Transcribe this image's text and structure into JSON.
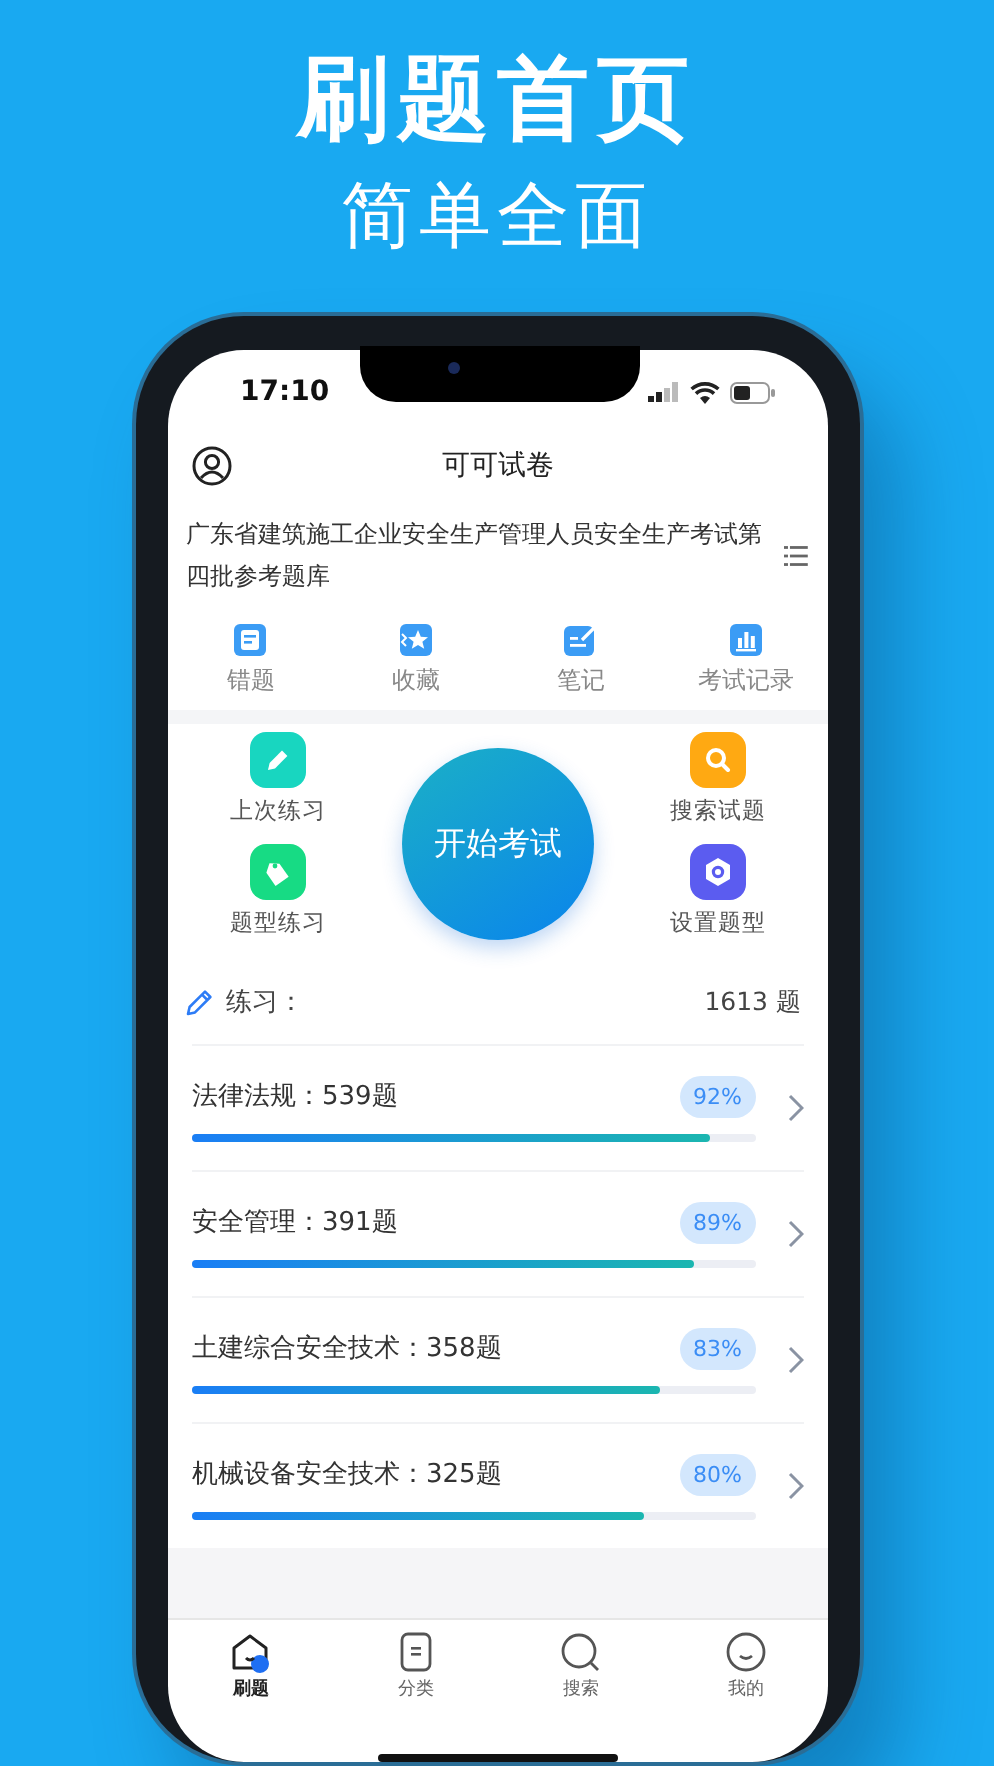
{
  "headline": "刷题首页",
  "subheadline": "简单全面",
  "status_bar": {
    "time": "17:10"
  },
  "nav": {
    "title": "可可试卷"
  },
  "bank": {
    "title": "广东省建筑施工企业安全生产管理人员安全生产考试第四批参考题库"
  },
  "shortcuts": [
    {
      "label": "错题",
      "kind": "mistakes"
    },
    {
      "label": "收藏",
      "kind": "favorites"
    },
    {
      "label": "笔记",
      "kind": "notes"
    },
    {
      "label": "考试记录",
      "kind": "records"
    }
  ],
  "actions": [
    {
      "label": "上次练习",
      "kind": "pencil"
    },
    {
      "label": "搜索试题",
      "kind": "search"
    },
    {
      "label": "题型练习",
      "kind": "tag"
    },
    {
      "label": "设置题型",
      "kind": "settings"
    }
  ],
  "start_button": {
    "label": "开始考试"
  },
  "practice": {
    "label": "练习：",
    "count": "1613 题"
  },
  "subjects": [
    {
      "title": "法律法规：539题",
      "percent": "92%",
      "level": 0.92
    },
    {
      "title": "安全管理：391题",
      "percent": "89%",
      "level": 0.89
    },
    {
      "title": "土建综合安全技术：358题",
      "percent": "83%",
      "level": 0.83
    },
    {
      "title": "机械设备安全技术：325题",
      "percent": "80%",
      "level": 0.8
    }
  ],
  "tabs": [
    {
      "label": "刷题",
      "kind": "home",
      "selected": true
    },
    {
      "label": "分类",
      "kind": "category",
      "selected": false
    },
    {
      "label": "搜索",
      "kind": "search",
      "selected": false
    },
    {
      "label": "我的",
      "kind": "profile",
      "selected": false
    }
  ]
}
